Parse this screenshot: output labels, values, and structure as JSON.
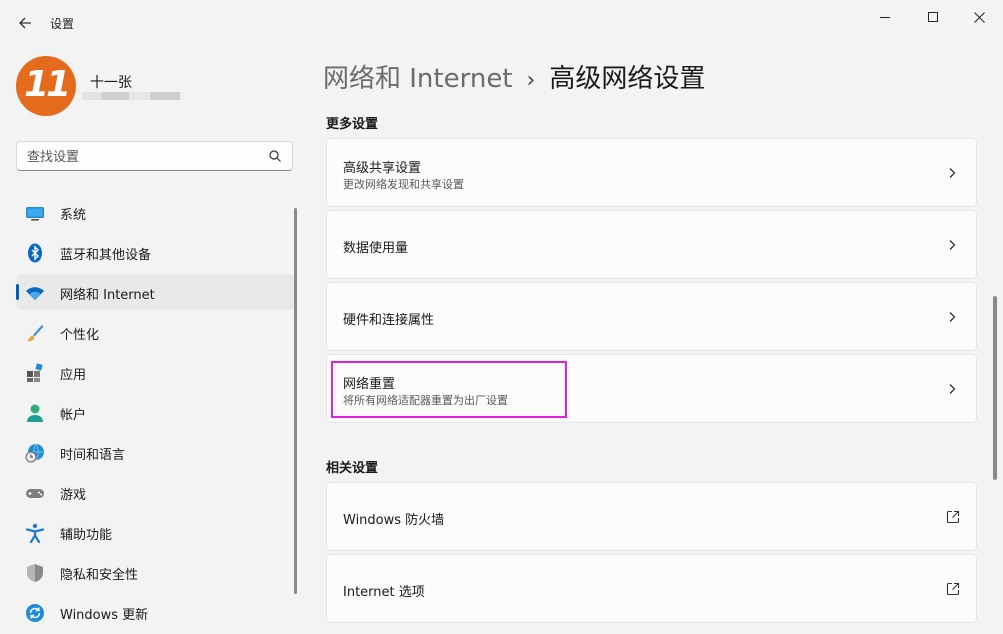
{
  "window": {
    "title": "设置"
  },
  "profile": {
    "name": "十一张"
  },
  "search": {
    "placeholder": "查找设置"
  },
  "nav": [
    {
      "label": "系统",
      "icon": "system-icon"
    },
    {
      "label": "蓝牙和其他设备",
      "icon": "bluetooth-icon"
    },
    {
      "label": "网络和 Internet",
      "icon": "wifi-icon",
      "active": true
    },
    {
      "label": "个性化",
      "icon": "brush-icon"
    },
    {
      "label": "应用",
      "icon": "apps-icon"
    },
    {
      "label": "帐户",
      "icon": "account-icon"
    },
    {
      "label": "时间和语言",
      "icon": "globe-clock-icon"
    },
    {
      "label": "游戏",
      "icon": "gamepad-icon"
    },
    {
      "label": "辅助功能",
      "icon": "accessibility-icon"
    },
    {
      "label": "隐私和安全性",
      "icon": "shield-icon"
    },
    {
      "label": "Windows 更新",
      "icon": "update-icon"
    }
  ],
  "breadcrumb": {
    "parent": "网络和 Internet",
    "separator": "›",
    "current": "高级网络设置"
  },
  "sections": {
    "more": {
      "title": "更多设置",
      "items": [
        {
          "title": "高级共享设置",
          "subtitle": "更改网络发现和共享设置"
        },
        {
          "title": "数据使用量"
        },
        {
          "title": "硬件和连接属性"
        },
        {
          "title": "网络重置",
          "subtitle": "将所有网络适配器重置为出厂设置"
        }
      ]
    },
    "related": {
      "title": "相关设置",
      "items": [
        {
          "title": "Windows 防火墙"
        },
        {
          "title": "Internet 选项"
        }
      ]
    }
  },
  "colors": {
    "accent": "#005fb8",
    "highlight": "#e020e0",
    "avatar": "#e46a1c"
  }
}
